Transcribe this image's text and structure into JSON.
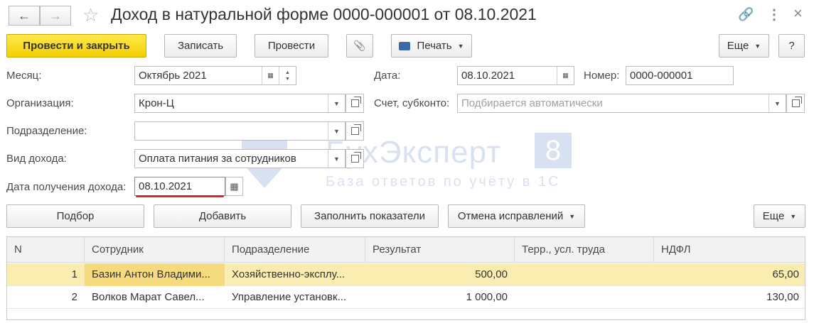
{
  "window": {
    "title": "Доход в натуральной форме 0000-000001 от 08.10.2021",
    "back_icon": "←",
    "forward_icon": "→",
    "star_icon": "☆",
    "link_icon": "🔗",
    "more_icon": "⋮",
    "close_icon": "×"
  },
  "toolbar": {
    "post_close": "Провести и закрыть",
    "save": "Записать",
    "post": "Провести",
    "attach_icon": "📎",
    "print": "Печать",
    "more": "Еще",
    "help": "?"
  },
  "form": {
    "month_label": "Месяц:",
    "month_value": "Октябрь 2021",
    "org_label": "Организация:",
    "org_value": "Крон-Ц",
    "dept_label": "Подразделение:",
    "dept_value": "",
    "income_type_label": "Вид дохода:",
    "income_type_value": "Оплата питания за сотрудников",
    "receipt_date_label": "Дата получения дохода:",
    "receipt_date_value": "08.10.2021",
    "date_label": "Дата:",
    "date_value": "08.10.2021",
    "number_label": "Номер:",
    "number_value": "0000-000001",
    "account_label": "Счет, субконто:",
    "account_placeholder": "Подбирается автоматически"
  },
  "watermark": {
    "brand": "БухЭксперт",
    "brand_num": "8",
    "tagline": "База ответов по учёту в 1С"
  },
  "table_toolbar": {
    "select": "Подбор",
    "add": "Добавить",
    "fill": "Заполнить показатели",
    "cancel_corrections": "Отмена исправлений",
    "more": "Еще"
  },
  "table": {
    "columns": [
      "N",
      "Сотрудник",
      "Подразделение",
      "Результат",
      "Терр., усл. труда",
      "НДФЛ"
    ],
    "rows": [
      {
        "n": "1",
        "employee": "Базин Антон Владими...",
        "dept": "Хозяйственно-эксплу...",
        "result": "500,00",
        "terr": "",
        "ndfl": "65,00"
      },
      {
        "n": "2",
        "employee": "Волков Марат Савел...",
        "dept": "Управление установк...",
        "result": "1 000,00",
        "terr": "",
        "ndfl": "130,00"
      }
    ]
  },
  "colors": {
    "primary_button": "#f4cf00",
    "selected_row": "#fbecb0",
    "underline": "#d62a2a"
  }
}
